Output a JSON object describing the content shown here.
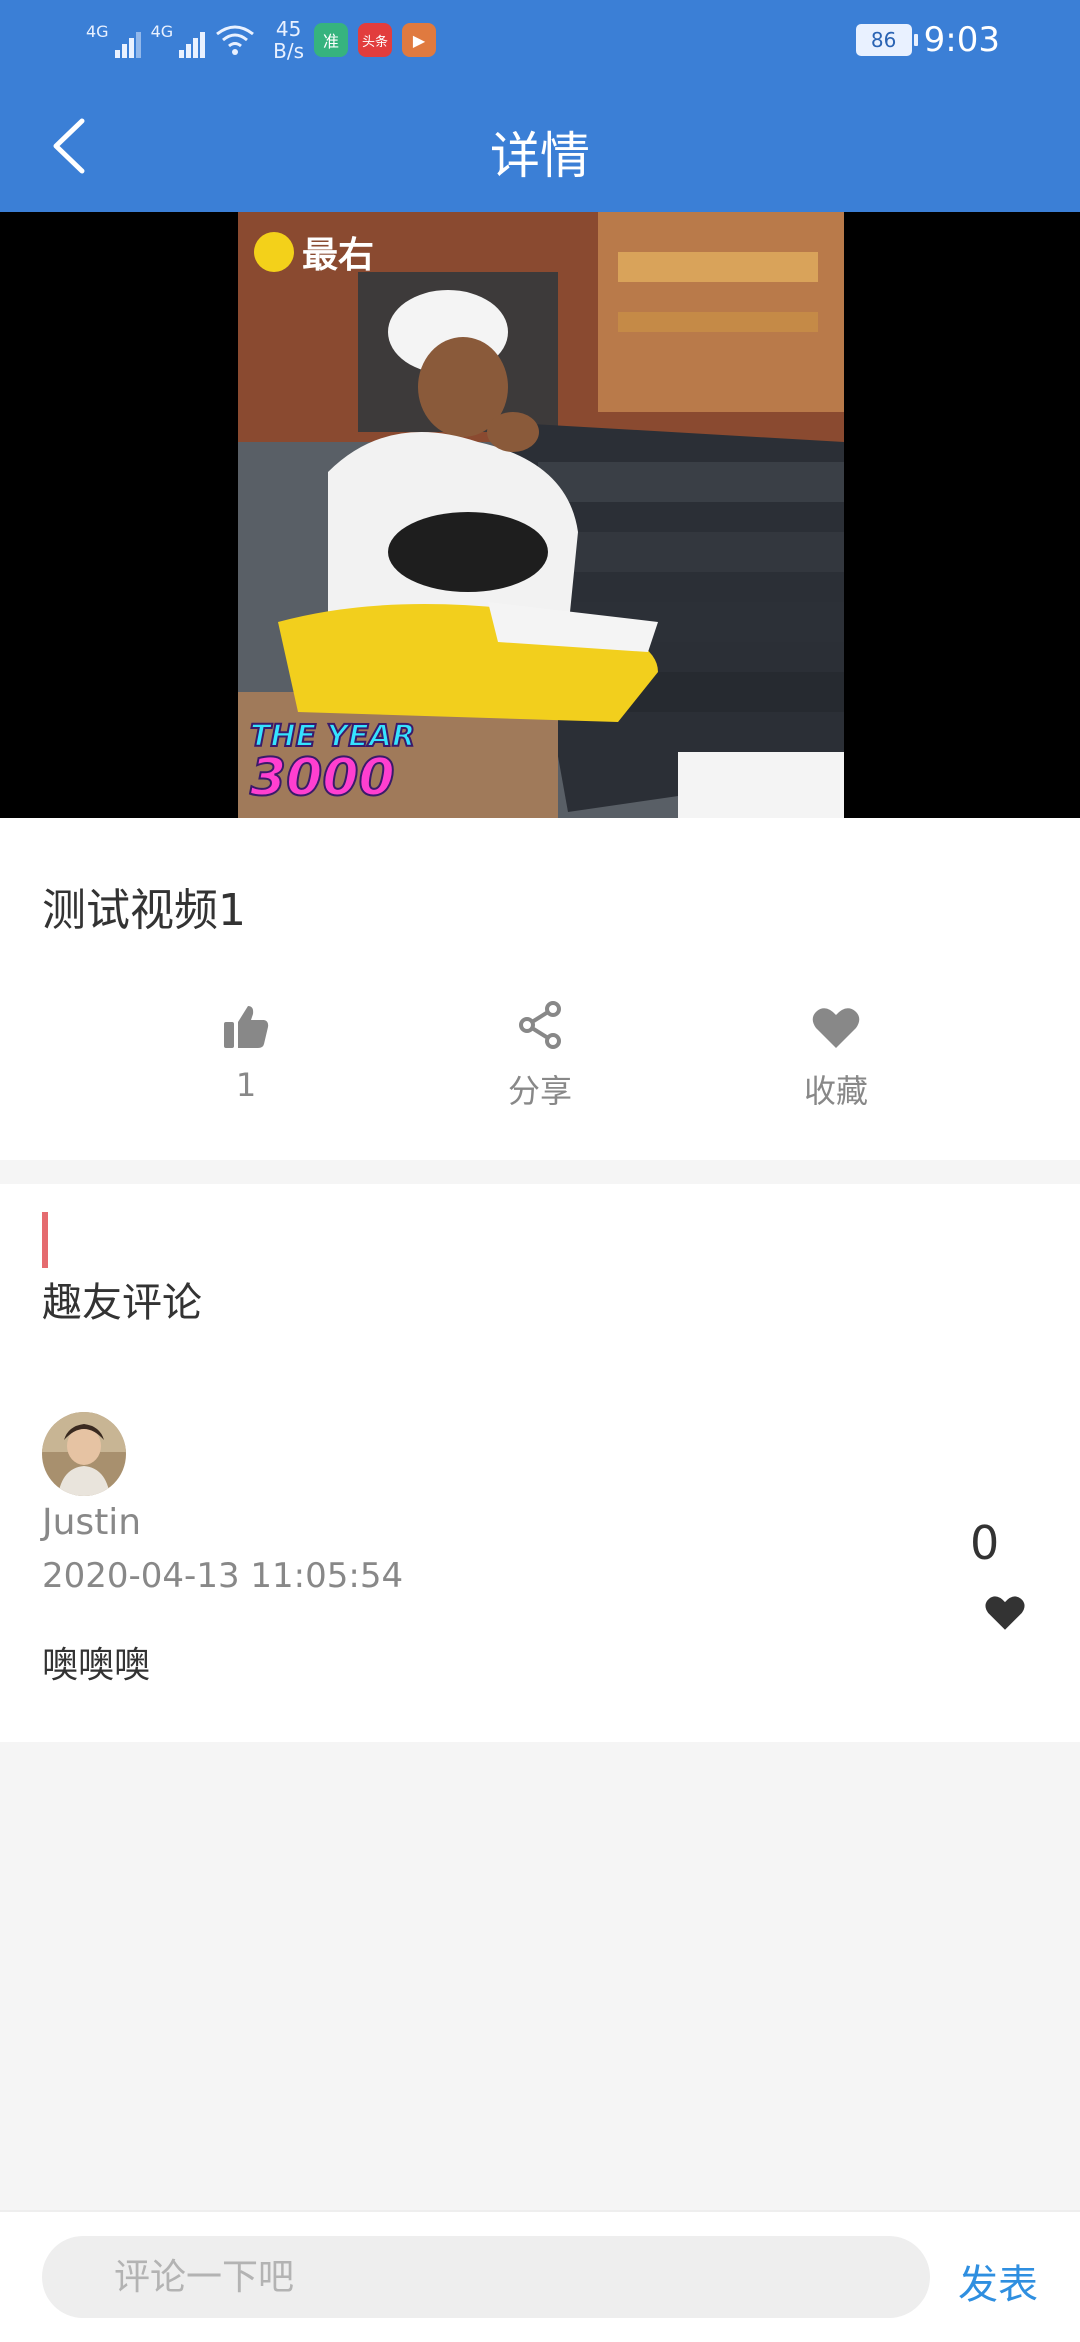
{
  "status_bar": {
    "net1": "4G",
    "net2": "4G",
    "speed_value": "45",
    "speed_unit": "B/s",
    "app_icons": [
      {
        "label": "准",
        "color": "#36b37e"
      },
      {
        "label": "头条",
        "color": "#e23d3d"
      },
      {
        "label": "▶",
        "color": "#e07a3f"
      }
    ],
    "battery": "86",
    "time": "9:03"
  },
  "app_bar": {
    "back_icon": "chevron-left-icon",
    "title": "详情"
  },
  "video": {
    "watermark": "最右",
    "overlay_line1": "THE YEAR",
    "overlay_line2": "3000"
  },
  "info": {
    "title": "测试视频1",
    "actions": [
      {
        "icon": "thumbs-up-icon",
        "label": "1"
      },
      {
        "icon": "share-icon",
        "label": "分享"
      },
      {
        "icon": "heart-icon",
        "label": "收藏"
      }
    ]
  },
  "comments": {
    "section_title": "趣友评论",
    "items": [
      {
        "username": "Justin",
        "time": "2020-04-13 11:05:54",
        "text": "噢噢噢",
        "likes": "0"
      }
    ]
  },
  "comment_bar": {
    "placeholder": "评论一下吧",
    "send_label": "发表"
  },
  "colors": {
    "header": "#3b7fd6",
    "accent_bar": "#e56b6f",
    "send": "#2f8fe0"
  }
}
